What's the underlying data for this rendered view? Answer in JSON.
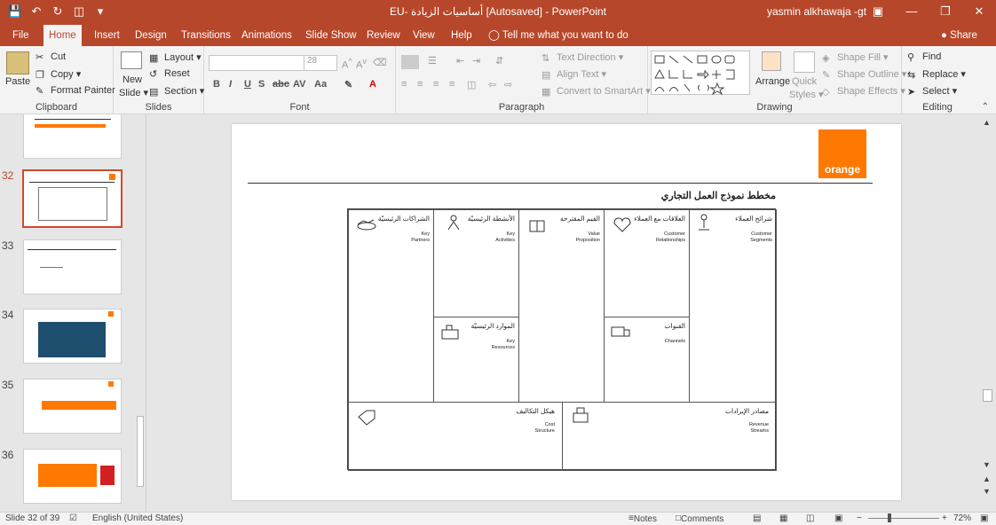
{
  "titlebar": {
    "document_title": "EU- أساسيات الزيادة [Autosaved]  -  PowerPoint",
    "user": "yasmin alkhawaja -gt"
  },
  "tabs": [
    "File",
    "Home",
    "Insert",
    "Design",
    "Transitions",
    "Animations",
    "Slide Show",
    "Review",
    "View",
    "Help"
  ],
  "active_tab": "Home",
  "tellme": "Tell me what you want to do",
  "share": "Share",
  "ribbon": {
    "clipboard": {
      "paste": "Paste",
      "cut": "Cut",
      "copy": "Copy",
      "format_painter": "Format Painter",
      "label": "Clipboard"
    },
    "slides": {
      "new_slide": "New",
      "new_slide_2": "Slide",
      "layout": "Layout",
      "reset": "Reset",
      "section": "Section",
      "label": "Slides"
    },
    "font": {
      "font_name": "",
      "font_size": "28",
      "label": "Font"
    },
    "paragraph": {
      "text_direction": "Text Direction",
      "align_text": "Align Text",
      "convert_smartart": "Convert to SmartArt",
      "label": "Paragraph"
    },
    "drawing": {
      "arrange": "Arrange",
      "quick_styles_1": "Quick",
      "quick_styles_2": "Styles",
      "shape_fill": "Shape Fill",
      "shape_outline": "Shape Outline",
      "shape_effects": "Shape Effects",
      "label": "Drawing"
    },
    "editing": {
      "find": "Find",
      "replace": "Replace",
      "select": "Select",
      "label": "Editing"
    }
  },
  "thumbnails": [
    {
      "num": "",
      "selected": false
    },
    {
      "num": "32",
      "selected": true
    },
    {
      "num": "33",
      "selected": false
    },
    {
      "num": "34",
      "selected": false
    },
    {
      "num": "35",
      "selected": false
    },
    {
      "num": "36",
      "selected": false
    }
  ],
  "slide": {
    "logo_text": "orange",
    "title": "مخطط نموذج العمل التجاري",
    "cells": {
      "key_partners": {
        "ar": "الشراكات الرئيسيّة",
        "en": "Key\nPartners"
      },
      "key_activities": {
        "ar": "الأنشطة الرئيسيّة",
        "en": "Key\nActivities"
      },
      "value_proposition": {
        "ar": "القيم المقترحة",
        "en": "Value\nProposition"
      },
      "customer_relationships": {
        "ar": "العلاقات مع العملاء",
        "en": "Customer\nRelationships"
      },
      "customer_segments": {
        "ar": "شرائح العملاء",
        "en": "Customer\nSegments"
      },
      "key_resources": {
        "ar": "الموارد الرئيسيّة",
        "en": "Key\nResources"
      },
      "channels": {
        "ar": "القنوات",
        "en": "Channels"
      },
      "cost_structure": {
        "ar": "هيكل التكاليف",
        "en": "Cost\nStructure"
      },
      "revenue_streams": {
        "ar": "مصادر الإيرادات",
        "en": "Revenue\nStreams"
      }
    }
  },
  "status": {
    "slide_count": "Slide 32 of 39",
    "language": "English (United States)",
    "notes": "Notes",
    "comments": "Comments",
    "zoom": "72%"
  },
  "colors": {
    "accent": "#b7472a",
    "orange": "#ff7900",
    "selected_thumb": "#d24726"
  }
}
